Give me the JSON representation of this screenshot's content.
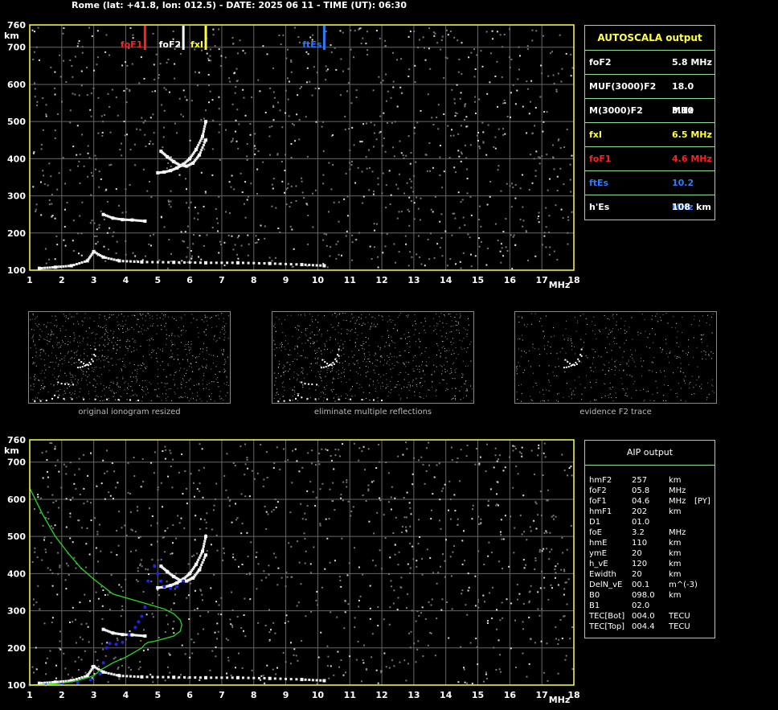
{
  "header": "Rome (lat: +41.8, lon: 012.5) - DATE: 2025 06 11 - TIME (UT): 06:30",
  "colors": {
    "frame": "#ffff44",
    "grid": "#666666",
    "foF1": "#ff2020",
    "foF2": "#ffffff",
    "fxI": "#ffff33",
    "ftEs": "#2d7cff",
    "profile": "#22dd22",
    "fit": "#2020ff",
    "table_border": "#8fe08f"
  },
  "chart_data": [
    {
      "type": "scatter",
      "title": "",
      "xlabel": "MHz",
      "ylabel": "km",
      "xlim": [
        1,
        18
      ],
      "ylim": [
        100,
        760
      ],
      "x_ticks": [
        "1",
        "2",
        "3",
        "4",
        "5",
        "6",
        "7",
        "8",
        "9",
        "10",
        "11",
        "12",
        "13",
        "14",
        "15",
        "16",
        "17",
        "18"
      ],
      "y_ticks": [
        "100",
        "200",
        "300",
        "400",
        "500",
        "600",
        "700",
        "760"
      ],
      "grid": true,
      "markers": [
        {
          "name": "foF1",
          "x": 4.6
        },
        {
          "name": "foF2",
          "x": 5.8
        },
        {
          "name": "fxI",
          "x": 6.5
        },
        {
          "name": "ftEs",
          "x": 10.2
        }
      ],
      "series": [
        {
          "name": "",
          "x": [
            5.0,
            5.2,
            5.4,
            5.6,
            5.8,
            6.0,
            6.2,
            6.4,
            6.5
          ],
          "y": [
            362,
            364,
            368,
            375,
            385,
            400,
            425,
            460,
            500
          ]
        },
        {
          "name": "",
          "x": [
            5.1,
            5.3,
            5.5,
            5.7,
            5.9,
            6.1,
            6.3,
            6.5
          ],
          "y": [
            420,
            405,
            392,
            382,
            380,
            388,
            410,
            450
          ]
        },
        {
          "name": "",
          "x": [
            3.3,
            3.6,
            3.9,
            4.2,
            4.6
          ],
          "y": [
            250,
            240,
            236,
            235,
            232
          ]
        },
        {
          "name": "",
          "x": [
            1.3,
            1.8,
            2.3,
            2.8,
            3.0,
            3.3,
            3.8,
            4.5,
            5.5,
            6.5,
            7.5,
            8.5,
            9.5,
            10.2
          ],
          "y": [
            105,
            108,
            112,
            125,
            150,
            135,
            125,
            122,
            121,
            120,
            120,
            118,
            115,
            112
          ]
        }
      ]
    },
    {
      "type": "scatter",
      "title": "",
      "xlabel": "MHz",
      "ylabel": "km",
      "xlim": [
        1,
        18
      ],
      "ylim": [
        100,
        760
      ],
      "x_ticks": [
        "1",
        "2",
        "3",
        "4",
        "5",
        "6",
        "7",
        "8",
        "9",
        "10",
        "11",
        "12",
        "13",
        "14",
        "15",
        "16",
        "17",
        "18"
      ],
      "y_ticks": [
        "100",
        "200",
        "300",
        "400",
        "500",
        "600",
        "700",
        "760"
      ],
      "grid": true,
      "series": [
        {
          "name": "",
          "x": [
            5.0,
            5.2,
            5.4,
            5.6,
            5.8,
            6.0,
            6.2,
            6.4,
            6.5
          ],
          "y": [
            362,
            364,
            368,
            375,
            385,
            400,
            425,
            460,
            500
          ]
        },
        {
          "name": "",
          "x": [
            5.1,
            5.3,
            5.5,
            5.7,
            5.9,
            6.1,
            6.3,
            6.5
          ],
          "y": [
            420,
            405,
            392,
            382,
            380,
            388,
            410,
            450
          ]
        },
        {
          "name": "",
          "x": [
            3.3,
            3.6,
            3.9,
            4.2,
            4.6
          ],
          "y": [
            250,
            240,
            236,
            235,
            232
          ]
        },
        {
          "name": "",
          "x": [
            1.3,
            1.8,
            2.3,
            2.8,
            3.0,
            3.3,
            3.8,
            4.5,
            5.5,
            6.5,
            7.5,
            8.5,
            9.5,
            10.2
          ],
          "y": [
            105,
            108,
            112,
            125,
            150,
            135,
            125,
            122,
            121,
            120,
            120,
            118,
            115,
            112
          ]
        },
        {
          "name": "",
          "x": [
            1.0,
            1.4,
            1.8,
            2.2,
            2.6,
            3.0,
            3.3,
            3.6,
            4.0,
            4.4,
            4.8,
            5.2,
            5.5,
            5.7,
            5.75,
            5.7,
            5.5,
            5.2,
            4.9,
            4.7,
            4.6,
            4.5,
            4.3,
            4.0,
            3.6,
            3.2,
            3.0,
            2.5,
            2.0,
            1.5,
            1.0
          ],
          "y": [
            630,
            560,
            500,
            455,
            415,
            385,
            365,
            345,
            335,
            325,
            315,
            305,
            292,
            275,
            262,
            245,
            232,
            225,
            218,
            215,
            210,
            200,
            190,
            175,
            160,
            140,
            125,
            112,
            105,
            102,
            100
          ]
        },
        {
          "name": "",
          "x": [
            1.0,
            1.5,
            2.0,
            2.5,
            2.9,
            3.2,
            3.3,
            3.4,
            3.5,
            3.7,
            3.9,
            4.1,
            4.3,
            4.4,
            4.5,
            4.6,
            4.7,
            4.9,
            5.0,
            5.1,
            5.2,
            5.4,
            5.6,
            5.8
          ],
          "y": [
            100,
            100,
            102,
            106,
            114,
            130,
            160,
            200,
            212,
            210,
            215,
            235,
            255,
            270,
            285,
            310,
            380,
            420,
            400,
            380,
            365,
            360,
            365,
            380
          ]
        }
      ]
    }
  ],
  "autoscala": {
    "title": "AUTOSCALA output",
    "rows": [
      {
        "key": "foF2",
        "value": "5.8 MHz",
        "unit": ""
      },
      {
        "key": "MUF(3000)F2",
        "value": "18.0 MHz",
        "unit": ""
      },
      {
        "key": "M(3000)F2",
        "value": "3.10",
        "unit": ""
      },
      {
        "key": "fxI",
        "value": "6.5 MHz",
        "unit": ""
      },
      {
        "key": "foF1",
        "value": "4.6 MHz",
        "unit": ""
      },
      {
        "key": "ftEs",
        "value": "10.2 MHz",
        "unit": ""
      },
      {
        "key": "h'Es",
        "value": "108",
        "unit": "km"
      }
    ]
  },
  "thumbnails": [
    {
      "caption": "original ionogram resized"
    },
    {
      "caption": "eliminate multiple reflections"
    },
    {
      "caption": "evidence F2 trace"
    }
  ],
  "aip": {
    "title": "AIP output",
    "rows": [
      {
        "k": "hmF2",
        "v": "257",
        "u": "km",
        "x": ""
      },
      {
        "k": "foF2",
        "v": "05.8",
        "u": "MHz",
        "x": ""
      },
      {
        "k": "foF1",
        "v": "04.6",
        "u": "MHz",
        "x": "[PY]"
      },
      {
        "k": "hmF1",
        "v": "202",
        "u": "km",
        "x": ""
      },
      {
        "k": "D1",
        "v": "01.0",
        "u": "",
        "x": ""
      },
      {
        "k": "foE",
        "v": "3.2",
        "u": "MHz",
        "x": ""
      },
      {
        "k": "hmE",
        "v": "110",
        "u": "km",
        "x": ""
      },
      {
        "k": "ymE",
        "v": "20",
        "u": "km",
        "x": ""
      },
      {
        "k": "h_vE",
        "v": "120",
        "u": "km",
        "x": ""
      },
      {
        "k": "Ewidth",
        "v": "20",
        "u": "km",
        "x": ""
      },
      {
        "k": "DelN_vE",
        "v": "00.1",
        "u": "m^(-3)",
        "x": ""
      },
      {
        "k": "B0",
        "v": "098.0",
        "u": "km",
        "x": ""
      },
      {
        "k": "B1",
        "v": "02.0",
        "u": "",
        "x": ""
      },
      {
        "k": "TEC[Bot]",
        "v": "004.0",
        "u": "TECU",
        "x": ""
      },
      {
        "k": "TEC[Top]",
        "v": "004.4",
        "u": "TECU",
        "x": ""
      }
    ]
  }
}
